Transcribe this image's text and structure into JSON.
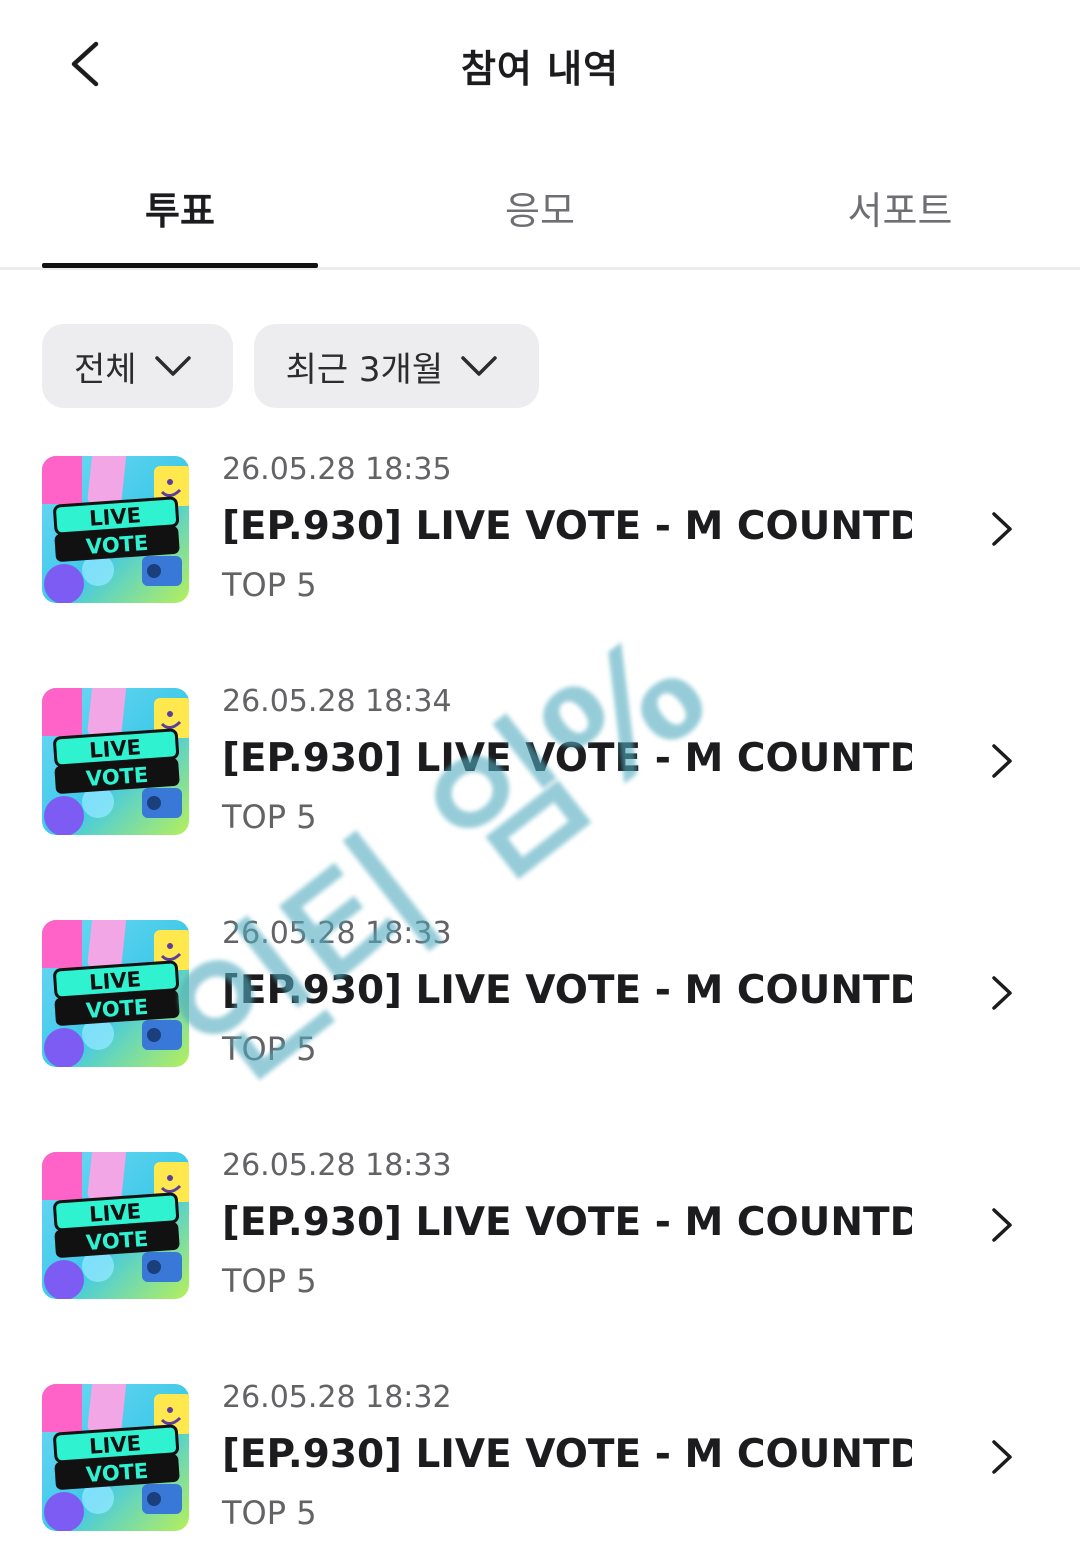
{
  "header": {
    "title": "참여 내역",
    "back_icon": "chevron-left-icon"
  },
  "tabs": [
    {
      "label": "투표",
      "active": true
    },
    {
      "label": "응모",
      "active": false
    },
    {
      "label": "서포트",
      "active": false
    }
  ],
  "filters": [
    {
      "label": "전체"
    },
    {
      "label": "최근 3개월"
    }
  ],
  "thumbnail": {
    "line1": "LIVE",
    "line2": "VOTE"
  },
  "items": [
    {
      "date": "26.05.28 18:35",
      "title": "[EP.930] LIVE VOTE - M COUNTD...",
      "subtitle": "TOP 5"
    },
    {
      "date": "26.05.28 18:34",
      "title": "[EP.930] LIVE VOTE - M COUNTD...",
      "subtitle": "TOP 5"
    },
    {
      "date": "26.05.28 18:33",
      "title": "[EP.930] LIVE VOTE - M COUNTD...",
      "subtitle": "TOP 5"
    },
    {
      "date": "26.05.28 18:33",
      "title": "[EP.930] LIVE VOTE - M COUNTD...",
      "subtitle": "TOP 5"
    },
    {
      "date": "26.05.28 18:32",
      "title": "[EP.930] LIVE VOTE - M COUNTD...",
      "subtitle": "TOP 5"
    }
  ],
  "watermark": "인티 임%",
  "colors": {
    "accent": "#111111",
    "chip_bg": "#ededef",
    "divider": "#ececee",
    "secondary_text": "#636366"
  }
}
